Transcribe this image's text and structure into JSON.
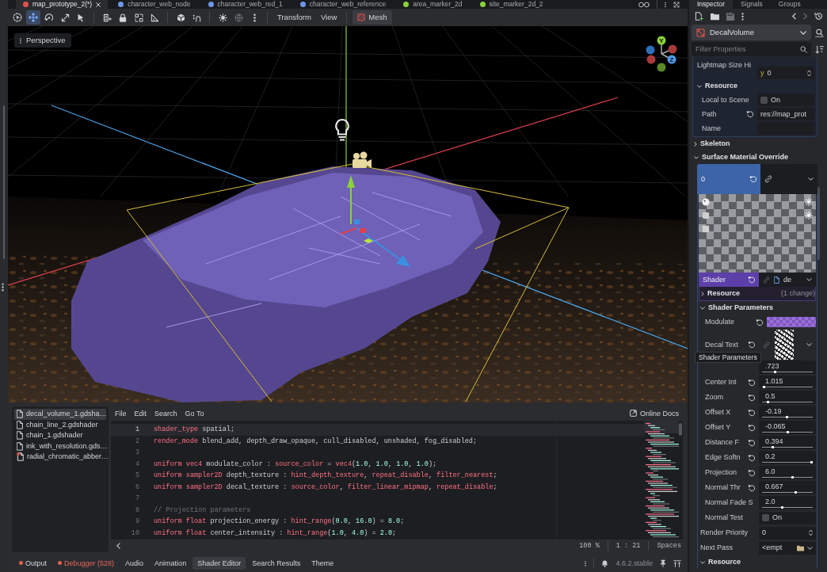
{
  "scene_tabs": [
    {
      "label": "map_prototype_2(*)",
      "selected": true,
      "color": "#e0524f",
      "closable": true
    },
    {
      "label": "character_web_node",
      "selected": false,
      "color": "#6e96e6"
    },
    {
      "label": "character_web_red_1",
      "selected": false,
      "color": "#6e96e6"
    },
    {
      "label": "character_web_reference",
      "selected": false,
      "color": "#6e96e6"
    },
    {
      "label": "area_marker_2d",
      "selected": false,
      "color": "#8ad13a"
    },
    {
      "label": "site_marker_2d_2",
      "selected": false,
      "color": "#8ad13a"
    }
  ],
  "toolbar": {
    "tools": [
      {
        "selected": false
      },
      {
        "selected": true
      },
      {
        "selected": false
      },
      {
        "selected": false
      },
      {
        "selected": false
      }
    ],
    "menus": [
      "Transform",
      "View"
    ],
    "mesh_menu": "Mesh"
  },
  "viewport": {
    "view_menu": "Perspective",
    "gizmo_labels": [
      "Y",
      "Z"
    ]
  },
  "inspector": {
    "tabs": [
      {
        "label": "Inspector",
        "selected": true
      },
      {
        "label": "Signals",
        "selected": false
      },
      {
        "label": "Groups",
        "selected": false
      }
    ],
    "node_type": "DecalVolume",
    "filter_placeholder": "Filter Properties",
    "properties": [
      {
        "kind": "panel",
        "children": [
          {
            "kind": "vector",
            "label": "Lightmap Size Hi",
            "axis": "y",
            "value": "0"
          },
          {
            "kind": "section",
            "label": "Resource",
            "expanded": true,
            "children": [
              {
                "kind": "check",
                "label": "Local to Scene",
                "checked": false,
                "text": "On"
              },
              {
                "kind": "text",
                "label": "Path",
                "revert": true,
                "value": "res://map_prot"
              },
              {
                "kind": "text",
                "label": "Name",
                "revert": false
              }
            ]
          }
        ]
      },
      {
        "kind": "section",
        "label": "Skeleton",
        "expanded": false
      },
      {
        "kind": "section",
        "label": "Surface Material Override",
        "expanded": true,
        "children": [
          {
            "kind": "material",
            "label": "0",
            "revert": true,
            "children": [
              {
                "kind": "preview"
              },
              {
                "kind": "shader",
                "label": "Shader",
                "revert": true,
                "value": "de",
                "children": [
                  {
                    "kind": "section",
                    "label": "Resource",
                    "expanded": false,
                    "note": "(1 change)"
                  }
                ]
              },
              {
                "kind": "section",
                "label": "Shader Parameters",
                "expanded": true,
                "children": [
                  {
                    "kind": "color",
                    "label": "Modulate",
                    "revert": true,
                    "color": "#9a6ee0"
                  },
                  {
                    "kind": "texture",
                    "label": "Decal Text",
                    "revert": true
                  },
                  {
                    "kind": "slider",
                    "value": ".723",
                    "level": 0.24
                  },
                  {
                    "kind": "slider",
                    "label": "Center Int",
                    "revert": true,
                    "value": "1.015",
                    "level": 0.02
                  },
                  {
                    "kind": "slider",
                    "label": "Zoom",
                    "revert": true,
                    "value": "0.5",
                    "level": 0.1
                  },
                  {
                    "kind": "slider",
                    "label": "Offset X",
                    "revert": true,
                    "value": "-0.19",
                    "level": 0.49
                  },
                  {
                    "kind": "slider",
                    "label": "Offset Y",
                    "revert": true,
                    "value": "-0.065",
                    "level": 0.5
                  },
                  {
                    "kind": "slider",
                    "label": "Distance F",
                    "revert": true,
                    "value": "0.394",
                    "level": 0.2
                  },
                  {
                    "kind": "slider",
                    "label": "Edge Softn",
                    "revert": true,
                    "value": "0.2",
                    "level": 1
                  },
                  {
                    "kind": "slider",
                    "label": "Projection",
                    "revert": true,
                    "value": "6.0",
                    "level": 0.61
                  },
                  {
                    "kind": "slider",
                    "label": "Normal Thr",
                    "revert": true,
                    "value": "0.667",
                    "level": 0.68
                  },
                  {
                    "kind": "slider",
                    "label": "Normal Fade S",
                    "revert": false,
                    "value": "2.0",
                    "level": 0.4
                  },
                  {
                    "kind": "check",
                    "label": "Normal Test",
                    "checked": false,
                    "text": "On"
                  }
                ]
              },
              {
                "kind": "spin",
                "label": "Render Priority",
                "value": "0"
              },
              {
                "kind": "resource",
                "label": "Next Pass",
                "value": "<empt"
              },
              {
                "kind": "section",
                "label": "Resource",
                "expanded": true
              }
            ]
          }
        ]
      }
    ],
    "tooltip": "Shader Parameters"
  },
  "script_list": [
    {
      "name": "decal_volume_1.gdsha…",
      "selected": true,
      "alert": false
    },
    {
      "name": "chain_line_2.gdshader",
      "selected": false,
      "alert": false
    },
    {
      "name": "chain_1.gdshader",
      "selected": false,
      "alert": false
    },
    {
      "name": "ink_with_resolution.gds…",
      "selected": false,
      "alert": false
    },
    {
      "name": "radial_chromatic_abber…",
      "selected": false,
      "alert": true
    }
  ],
  "script_editor": {
    "menus": [
      "File",
      "Edit",
      "Search",
      "Go To"
    ],
    "online_docs": "Online Docs",
    "lines": [
      {
        "number": "1",
        "current": true,
        "tokens": [
          {
            "kind": "keyword",
            "text": "shader_type"
          },
          {
            "kind": "plain",
            "text": " spatial;"
          }
        ]
      },
      {
        "number": "2",
        "current": false,
        "tokens": [
          {
            "kind": "keyword",
            "text": "render_mode"
          },
          {
            "kind": "plain",
            "text": " blend_add, depth_draw_opaque, cull_disabled, unshaded, fog_disabled;"
          }
        ]
      },
      {
        "number": "3",
        "current": false
      },
      {
        "number": "4",
        "current": false,
        "tokens": [
          {
            "kind": "keyword",
            "text": "uniform vec4"
          },
          {
            "kind": "plain",
            "text": " modulate_color : "
          },
          {
            "kind": "keyword",
            "text": "source_color"
          },
          {
            "kind": "plain",
            "text": " = "
          },
          {
            "kind": "keyword",
            "text": "vec4"
          },
          {
            "kind": "plain",
            "text": "("
          },
          {
            "kind": "number",
            "text": "1.0"
          },
          {
            "kind": "plain",
            "text": ", "
          },
          {
            "kind": "number",
            "text": "1.0"
          },
          {
            "kind": "plain",
            "text": ", "
          },
          {
            "kind": "number",
            "text": "1.0"
          },
          {
            "kind": "plain",
            "text": ", "
          },
          {
            "kind": "number",
            "text": "1.0"
          },
          {
            "kind": "plain",
            "text": ");"
          }
        ]
      },
      {
        "number": "5",
        "current": false,
        "tokens": [
          {
            "kind": "keyword",
            "text": "uniform sampler2D"
          },
          {
            "kind": "plain",
            "text": " depth_texture : "
          },
          {
            "kind": "keyword",
            "text": "hint_depth_texture"
          },
          {
            "kind": "plain",
            "text": ", "
          },
          {
            "kind": "keyword",
            "text": "repeat_disable"
          },
          {
            "kind": "plain",
            "text": ", "
          },
          {
            "kind": "keyword",
            "text": "filter_nearest"
          },
          {
            "kind": "plain",
            "text": ";"
          }
        ]
      },
      {
        "number": "6",
        "current": false,
        "tokens": [
          {
            "kind": "keyword",
            "text": "uniform sampler2D"
          },
          {
            "kind": "plain",
            "text": " decal_texture : "
          },
          {
            "kind": "keyword",
            "text": "source_color"
          },
          {
            "kind": "plain",
            "text": ", "
          },
          {
            "kind": "keyword",
            "text": "filter_linear_mipmap"
          },
          {
            "kind": "plain",
            "text": ", "
          },
          {
            "kind": "keyword",
            "text": "repeat_disable"
          },
          {
            "kind": "plain",
            "text": ";"
          }
        ]
      },
      {
        "number": "7",
        "current": false
      },
      {
        "number": "8",
        "current": false,
        "tokens": [
          {
            "kind": "comment",
            "text": "// Projection parameters"
          }
        ]
      },
      {
        "number": "9",
        "current": false,
        "tokens": [
          {
            "kind": "keyword",
            "text": "uniform float"
          },
          {
            "kind": "plain",
            "text": " projection_energy : "
          },
          {
            "kind": "keyword",
            "text": "hint_range"
          },
          {
            "kind": "plain",
            "text": "("
          },
          {
            "kind": "number",
            "text": "0.0"
          },
          {
            "kind": "plain",
            "text": ", "
          },
          {
            "kind": "number",
            "text": "16.0"
          },
          {
            "kind": "plain",
            "text": ") = "
          },
          {
            "kind": "number",
            "text": "8.0"
          },
          {
            "kind": "plain",
            "text": ";"
          }
        ]
      },
      {
        "number": "10",
        "current": false,
        "tokens": [
          {
            "kind": "keyword",
            "text": "uniform float"
          },
          {
            "kind": "plain",
            "text": " center_intensity : "
          },
          {
            "kind": "keyword",
            "text": "hint_range"
          },
          {
            "kind": "plain",
            "text": "("
          },
          {
            "kind": "number",
            "text": "1.0"
          },
          {
            "kind": "plain",
            "text": ", "
          },
          {
            "kind": "number",
            "text": "4.0"
          },
          {
            "kind": "plain",
            "text": ") = "
          },
          {
            "kind": "number",
            "text": "2.0"
          },
          {
            "kind": "plain",
            "text": ";"
          }
        ]
      }
    ],
    "status": {
      "zoom": "100 %",
      "position": "1 : 21",
      "indent": "Spaces"
    }
  },
  "bottom_tabs": [
    {
      "label": "Output",
      "selected": false,
      "dot": true,
      "error": false
    },
    {
      "label": "Debugger (528)",
      "selected": false,
      "dot": true,
      "error": true
    },
    {
      "label": "Audio",
      "selected": false,
      "dot": false,
      "error": false
    },
    {
      "label": "Animation",
      "selected": false,
      "dot": false,
      "error": false
    },
    {
      "label": "Shader Editor",
      "selected": true,
      "dot": false,
      "error": false
    },
    {
      "label": "Search Results",
      "selected": false,
      "dot": false,
      "error": false
    },
    {
      "label": "Theme",
      "selected": false,
      "dot": false,
      "error": false
    }
  ],
  "status_bar": {
    "version": "4.6.2.stable"
  }
}
